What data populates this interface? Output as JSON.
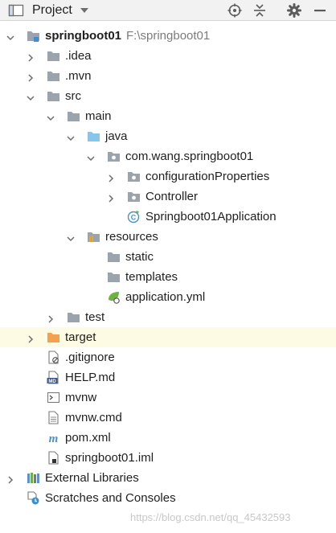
{
  "header": {
    "title": "Project"
  },
  "tree": [
    {
      "label": "springboot01",
      "hint": "F:\\springboot01",
      "icon": "module-folder-icon",
      "arrow": "down"
    },
    {
      "label": ".idea",
      "icon": "folder-icon",
      "arrow": "right"
    },
    {
      "label": ".mvn",
      "icon": "folder-icon",
      "arrow": "right"
    },
    {
      "label": "src",
      "icon": "folder-icon",
      "arrow": "down"
    },
    {
      "label": "main",
      "icon": "folder-icon",
      "arrow": "down"
    },
    {
      "label": "java",
      "icon": "source-folder-icon",
      "arrow": "down"
    },
    {
      "label": "com.wang.springboot01",
      "icon": "package-icon",
      "arrow": "down"
    },
    {
      "label": "configurationProperties",
      "icon": "package-icon",
      "arrow": "right"
    },
    {
      "label": "Controller",
      "icon": "package-icon",
      "arrow": "right"
    },
    {
      "label": "Springboot01Application",
      "icon": "spring-boot-class-icon",
      "arrow": ""
    },
    {
      "label": "resources",
      "icon": "resources-folder-icon",
      "arrow": "down"
    },
    {
      "label": "static",
      "icon": "folder-icon",
      "arrow": ""
    },
    {
      "label": "templates",
      "icon": "folder-icon",
      "arrow": ""
    },
    {
      "label": "application.yml",
      "icon": "spring-config-file-icon",
      "arrow": ""
    },
    {
      "label": "test",
      "icon": "folder-icon",
      "arrow": "right"
    },
    {
      "label": "target",
      "icon": "excluded-folder-icon",
      "arrow": "right"
    },
    {
      "label": ".gitignore",
      "icon": "ignore-file-icon",
      "arrow": ""
    },
    {
      "label": "HELP.md",
      "icon": "markdown-file-icon",
      "arrow": ""
    },
    {
      "label": "mvnw",
      "icon": "shell-script-icon",
      "arrow": ""
    },
    {
      "label": "mvnw.cmd",
      "icon": "text-file-icon",
      "arrow": ""
    },
    {
      "label": "pom.xml",
      "icon": "maven-icon",
      "arrow": ""
    },
    {
      "label": "springboot01.iml",
      "icon": "module-file-icon",
      "arrow": ""
    },
    {
      "label": "External Libraries",
      "icon": "external-libraries-icon",
      "arrow": "right"
    },
    {
      "label": "Scratches and Consoles",
      "icon": "scratches-icon",
      "arrow": ""
    }
  ],
  "watermark": "https://blog.csdn.net/qq_45432593"
}
